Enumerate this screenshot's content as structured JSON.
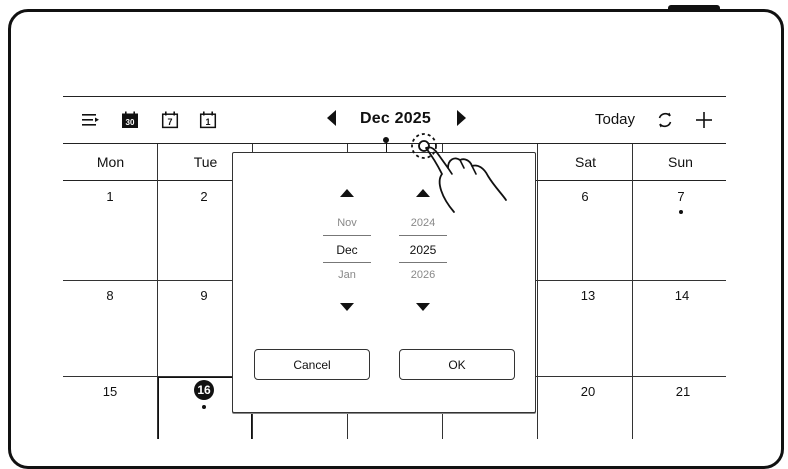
{
  "toolbar": {
    "icons": [
      "list-view-icon",
      "month-view-icon",
      "week-view-icon",
      "day-view-icon"
    ],
    "week_view_number": "7",
    "day_view_number": "1",
    "month_view_number": "30",
    "title": "Dec 2025",
    "today_label": "Today",
    "refresh_icon": "refresh-icon",
    "add_icon": "plus-icon"
  },
  "weekdays": [
    "Mon",
    "Tue",
    "Wed",
    "Thu",
    "Fri",
    "Sat",
    "Sun"
  ],
  "calendar": {
    "row1": [
      "1",
      "2",
      "6",
      "7"
    ],
    "row2": [
      "8",
      "9",
      "13",
      "14"
    ],
    "row3": [
      "15",
      "16",
      "20",
      "21"
    ],
    "today": "16",
    "event_days": [
      "7",
      "16"
    ]
  },
  "picker": {
    "month_prev": "Nov",
    "month_selected": "Dec",
    "month_next": "Jan",
    "year_prev": "2024",
    "year_selected": "2025",
    "year_next": "2026",
    "cancel_label": "Cancel",
    "ok_label": "OK"
  }
}
